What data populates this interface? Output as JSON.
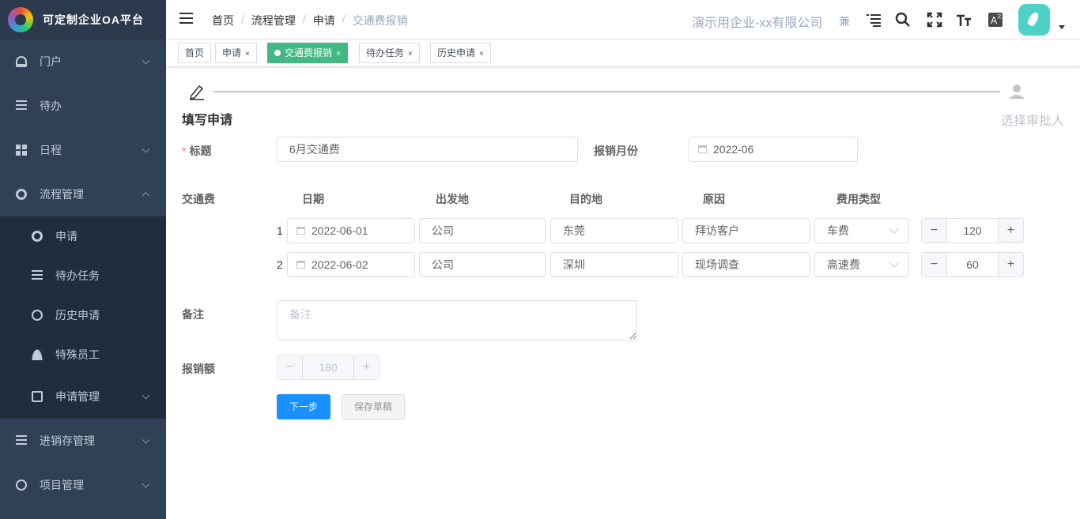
{
  "app": {
    "title": "可定制企业OA平台"
  },
  "sidebar": {
    "items": [
      {
        "label": "门户",
        "icon": "dashboard-icon"
      },
      {
        "label": "待办",
        "icon": "list-icon"
      },
      {
        "label": "日程",
        "icon": "grid-icon"
      },
      {
        "label": "流程管理",
        "icon": "workflow-icon"
      }
    ],
    "subitems": [
      {
        "label": "申请",
        "icon": "workflow-icon"
      },
      {
        "label": "待办任务",
        "icon": "list-icon"
      },
      {
        "label": "历史申请",
        "icon": "search-icon"
      },
      {
        "label": "特殊员工",
        "icon": "user-icon"
      },
      {
        "label": "申请管理",
        "icon": "document-icon"
      }
    ],
    "bottom_items": [
      {
        "label": "进销存管理",
        "icon": "tree-icon"
      },
      {
        "label": "项目管理",
        "icon": "eye-icon"
      }
    ]
  },
  "navbar": {
    "breadcrumb": [
      "首页",
      "流程管理",
      "申请",
      "交通费报销"
    ],
    "company": "演示用企业-xx有限公司",
    "font_char": "兼"
  },
  "tags": [
    {
      "label": "首页",
      "closable": false
    },
    {
      "label": "申请",
      "closable": true
    },
    {
      "label": "交通费报销",
      "closable": true,
      "active": true
    },
    {
      "label": "待办任务",
      "closable": true
    },
    {
      "label": "历史申请",
      "closable": true
    }
  ],
  "steps": {
    "current": "填写申请",
    "next": "选择审批人"
  },
  "form": {
    "title_label": "标题",
    "title_value": "6月交通费",
    "month_label": "报销月份",
    "month_value": "2022-06",
    "traffic_label": "交通费",
    "columns": [
      "日期",
      "出发地",
      "目的地",
      "原因",
      "费用类型"
    ],
    "rows": [
      {
        "idx": "1",
        "date": "2022-06-01",
        "from": "公司",
        "to": "东莞",
        "reason": "拜访客户",
        "type": "车费",
        "amount": "120"
      },
      {
        "idx": "2",
        "date": "2022-06-02",
        "from": "公司",
        "to": "深圳",
        "reason": "现场调查",
        "type": "高速费",
        "amount": "60"
      }
    ],
    "remark_label": "备注",
    "remark_placeholder": "备注",
    "total_label": "报销额",
    "total_value": "180",
    "next_button": "下一步",
    "draft_button": "保存草稿"
  },
  "colors": {
    "sidebar_bg": "#304156",
    "active_tag": "#42b983",
    "primary": "#1890ff"
  }
}
